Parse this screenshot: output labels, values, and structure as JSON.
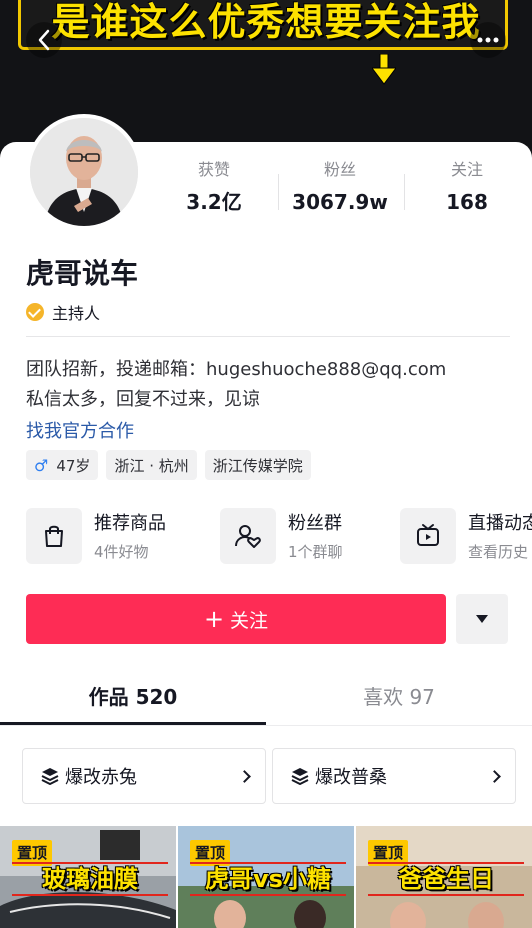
{
  "banner": {
    "text": "是谁这么优秀想要关注我"
  },
  "nav": {
    "back_icon": "chevron-left-icon",
    "more_icon": "more-dots-icon"
  },
  "profile": {
    "stats": [
      {
        "label": "获赞",
        "value": "3.2亿"
      },
      {
        "label": "粉丝",
        "value": "3067.9w"
      },
      {
        "label": "关注",
        "value": "168"
      }
    ],
    "name": "虎哥说车",
    "verification": "主持人",
    "bio_line1": "团队招新，投递邮箱：hugeshuoche888@qq.com",
    "bio_line2": "私信太多，回复不过来，见谅",
    "cooperation_link": "找我官方合作",
    "tags": {
      "age": "47岁",
      "location": "浙江 · 杭州",
      "school": "浙江传媒学院"
    }
  },
  "services": [
    {
      "title": "推荐商品",
      "subtitle": "4件好物",
      "icon": "shopping-bag-icon"
    },
    {
      "title": "粉丝群",
      "subtitle": "1个群聊",
      "icon": "fan-group-icon"
    },
    {
      "title": "直播动态",
      "subtitle": "查看历史",
      "icon": "tv-play-icon"
    }
  ],
  "actions": {
    "follow_plus": "+",
    "follow_label": "关注"
  },
  "tabs": [
    {
      "label": "作品 520",
      "active": true
    },
    {
      "label": "喜欢 97",
      "active": false
    }
  ],
  "collections": [
    {
      "label": "爆改赤兔"
    },
    {
      "label": "爆改普桑"
    }
  ],
  "videos": [
    {
      "pin": "置顶",
      "title": "玻璃油膜"
    },
    {
      "pin": "置顶",
      "title": "虎哥vs小糖"
    },
    {
      "pin": "置顶",
      "title": "爸爸生日"
    }
  ],
  "colors": {
    "accent_red": "#fe2c55",
    "link_blue": "#2b5aa8",
    "banner_yellow": "#fde200",
    "verify_orange": "#f5b52a"
  }
}
